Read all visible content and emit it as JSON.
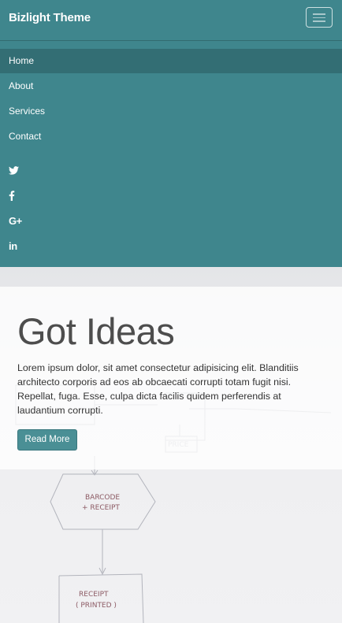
{
  "navbar": {
    "brand": "Bizlight Theme",
    "toggle_icon": "hamburger-menu-icon",
    "items": [
      {
        "label": "Home",
        "active": true
      },
      {
        "label": "About",
        "active": false
      },
      {
        "label": "Services",
        "active": false
      },
      {
        "label": "Contact",
        "active": false
      }
    ],
    "social": [
      {
        "icon": "twitter-icon"
      },
      {
        "icon": "facebook-icon"
      },
      {
        "icon": "google-plus-icon",
        "label": "G+"
      },
      {
        "icon": "linkedin-icon",
        "label": "in"
      }
    ],
    "colors": {
      "background": "#3f868d",
      "active_item": "#336e74"
    }
  },
  "hero": {
    "title": "Got Ideas",
    "text": "Lorem ipsum dolor, sit amet consectetur adipisicing elit. Blanditiis architecto corporis ad eos ab obcaecati corrupti totam fugit nisi. Repellat, fuga. Esse, culpa dicta facilis quidem perferendis at laudantium corrupti.",
    "button_label": "Read More",
    "sketch": {
      "labels": [
        "BARCODE + RECEIPT",
        "RECEIPT PRINTED",
        "PRICE"
      ]
    },
    "colors": {
      "button": "#4a8f95",
      "title": "#4d4d4d"
    }
  }
}
